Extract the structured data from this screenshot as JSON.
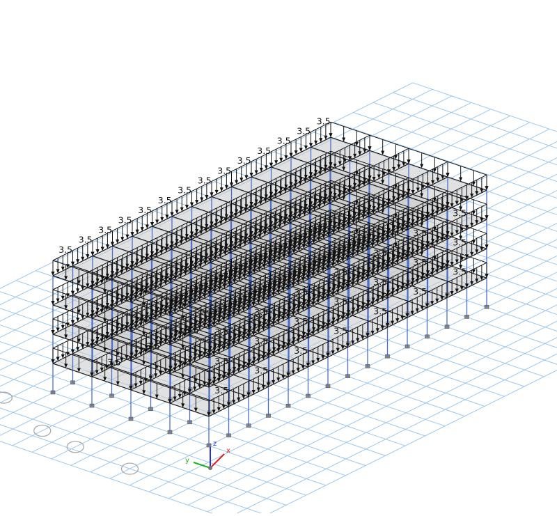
{
  "view": {
    "load_label": "3.5",
    "background": "#ffffff",
    "grid_color": "#9cc7ee",
    "frame_color": "#1a1a1a",
    "column_color": "#4a6fc9",
    "slab_color": "#c9c9c9",
    "arrow_color": "#111111",
    "axis_colors": {
      "x": "#e02020",
      "y": "#18b418",
      "z": "#2030e0"
    },
    "axis_labels": {
      "x": "x",
      "y": "y",
      "z": "z"
    }
  }
}
